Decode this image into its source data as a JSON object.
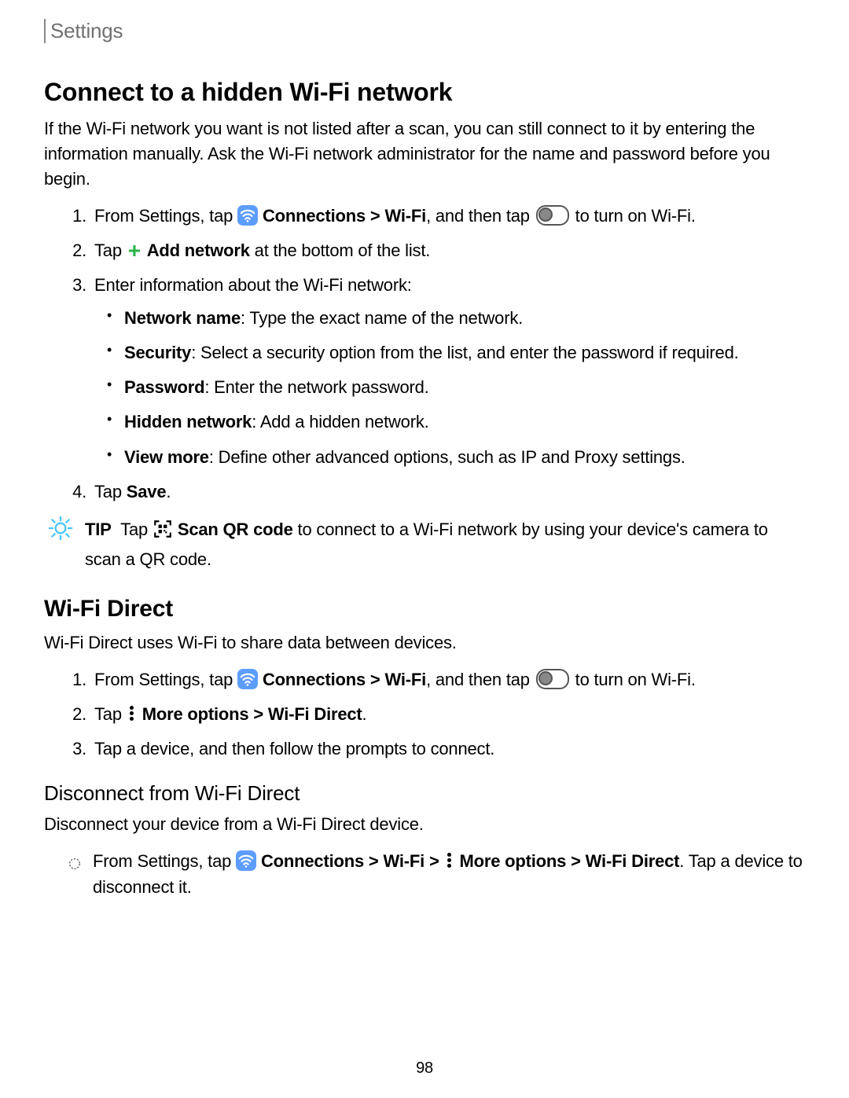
{
  "header": "Settings",
  "page_number": "98",
  "section1": {
    "title": "Connect to a hidden Wi-Fi network",
    "intro": "If the Wi-Fi network you want is not listed after a scan, you can still connect to it by entering the information manually. Ask the Wi-Fi network administrator for the name and password before you begin.",
    "step1_pre": "From Settings, tap ",
    "step1_conn": "Connections",
    "step1_gt": " > ",
    "step1_wifi": "Wi-Fi",
    "step1_mid": ", and then tap ",
    "step1_post": " to turn on Wi-Fi.",
    "step2_pre": "Tap ",
    "step2_add": "Add network",
    "step2_post": " at the bottom of the list.",
    "step3": "Enter information about the Wi-Fi network:",
    "bullets": [
      {
        "label": "Network name",
        "text": ": Type the exact name of the network."
      },
      {
        "label": "Security",
        "text": ": Select a security option from the list, and enter the password if required."
      },
      {
        "label": "Password",
        "text": ": Enter the network password."
      },
      {
        "label": "Hidden network",
        "text": ": Add a hidden network."
      },
      {
        "label": "View more",
        "text": ": Define other advanced options, such as IP and Proxy settings."
      }
    ],
    "step4_pre": "Tap ",
    "step4_save": "Save",
    "step4_post": ".",
    "tip": {
      "label": "TIP",
      "pre": "Tap ",
      "scan": "Scan QR code",
      "post": " to connect to a Wi-Fi network by using your device's camera to scan a QR code."
    }
  },
  "section2": {
    "title": "Wi-Fi Direct",
    "intro": "Wi-Fi Direct uses Wi-Fi to share data between devices.",
    "step1_pre": "From Settings, tap ",
    "step1_conn": "Connections",
    "step1_gt": " > ",
    "step1_wifi": "Wi-Fi",
    "step1_mid": ", and then tap ",
    "step1_post": " to turn on Wi-Fi.",
    "step2_pre": "Tap ",
    "step2_more": "More options",
    "step2_gt": " > ",
    "step2_direct": "Wi-Fi Direct",
    "step2_post": ".",
    "step3": "Tap a device, and then follow the prompts to connect."
  },
  "section3": {
    "title": "Disconnect from Wi-Fi Direct",
    "intro": "Disconnect your device from a Wi-Fi Direct device.",
    "line_pre": "From Settings, tap ",
    "line_conn": "Connections",
    "line_gt1": " > ",
    "line_wifi": "Wi-Fi",
    "line_gt2": " > ",
    "line_more": "More options",
    "line_gt3": " > ",
    "line_direct": "Wi-Fi Direct",
    "line_post": ". Tap a device to disconnect it."
  }
}
